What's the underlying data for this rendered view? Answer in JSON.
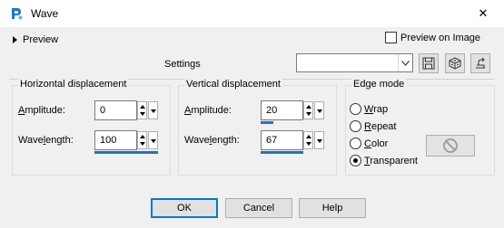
{
  "window": {
    "title": "Wave",
    "close_glyph": "✕"
  },
  "preview": {
    "label": "Preview",
    "preview_on_image_label": "Preview on Image",
    "preview_on_image_checked": false
  },
  "settings": {
    "label": "Settings",
    "preset_value": ""
  },
  "horizontal": {
    "group_label": "Horizontal displacement",
    "amplitude_label_underlined": "A",
    "amplitude_label_rest": "mplitude:",
    "amplitude_value": "0",
    "amplitude_slider": 0,
    "wavelength_label_pre": "Wave",
    "wavelength_label_underlined": "l",
    "wavelength_label_rest": "ength:",
    "wavelength_value": "100",
    "wavelength_slider": 1.0
  },
  "vertical": {
    "group_label": "Vertical displacement",
    "amplitude_label_underlined": "A",
    "amplitude_label_rest": "mplitude:",
    "amplitude_value": "20",
    "amplitude_slider": 0.2,
    "wavelength_label_pre": "Wave",
    "wavelength_label_underlined": "l",
    "wavelength_label_rest": "ength:",
    "wavelength_value": "67",
    "wavelength_slider": 0.67
  },
  "edge_mode": {
    "group_label": "Edge mode",
    "options": [
      {
        "underlined": "W",
        "rest": "rap",
        "checked": false
      },
      {
        "underlined": "R",
        "rest": "epeat",
        "checked": false
      },
      {
        "underlined": "C",
        "rest": "olor",
        "checked": false
      },
      {
        "underlined": "T",
        "rest": "ransparent",
        "checked": true
      }
    ]
  },
  "buttons": {
    "ok": "OK",
    "cancel": "Cancel",
    "help": "Help"
  },
  "colors": {
    "accent": "#1e74c8",
    "app_icon": "#1e74c8"
  }
}
